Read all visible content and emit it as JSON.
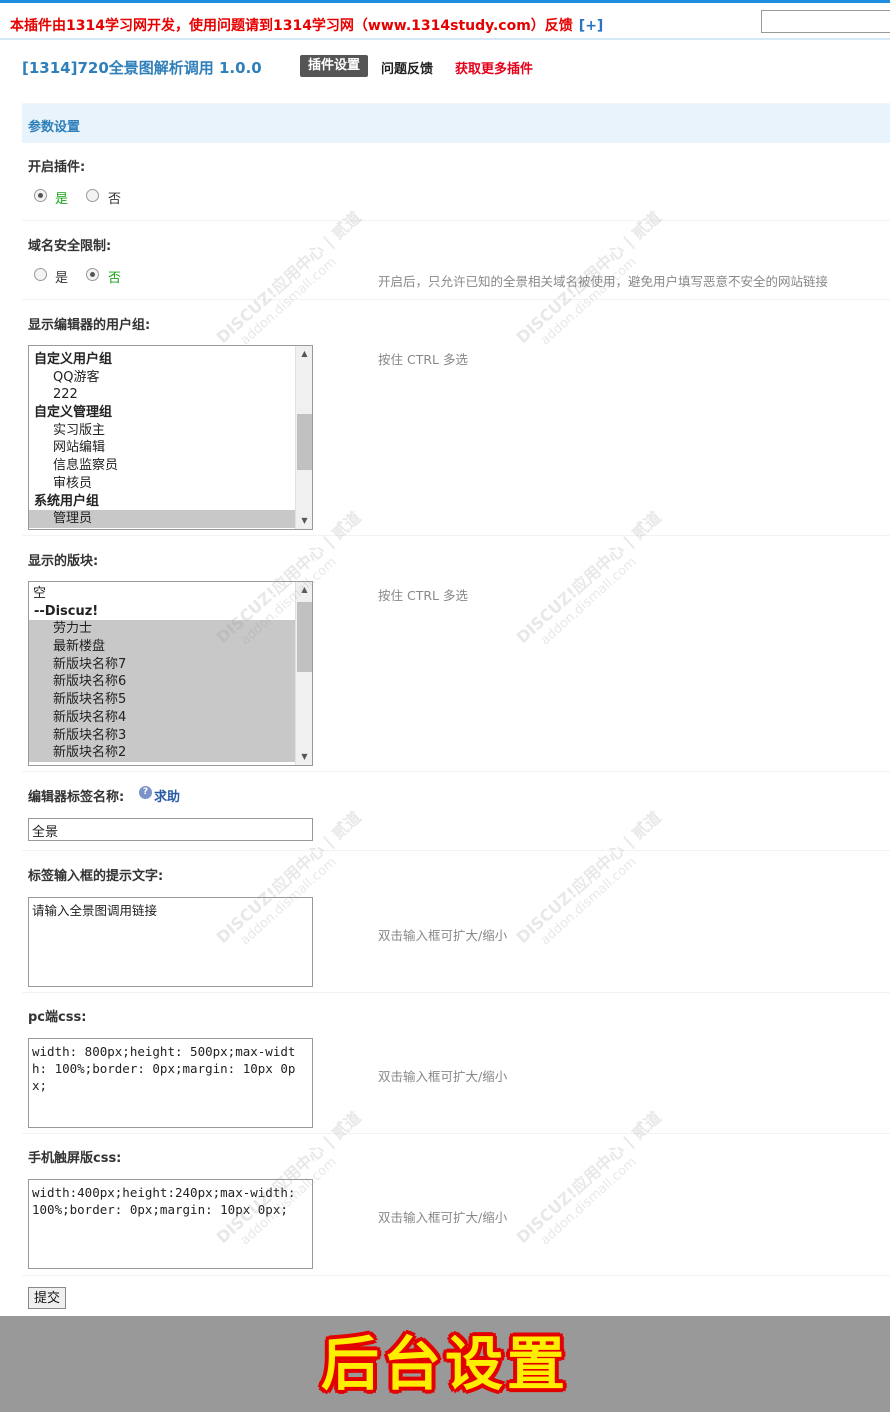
{
  "topbar": {
    "notice": "本插件由1314学习网开发，使用问题请到1314学习网（www.1314study.com）反馈",
    "plus": "[+]"
  },
  "header": {
    "title": "[1314]720全景图解析调用 1.0.0",
    "tabs": [
      "插件设置",
      "问题反馈",
      "获取更多插件"
    ]
  },
  "section": {
    "title": "参数设置"
  },
  "fields": {
    "enable": {
      "label": "开启插件:",
      "options": [
        "是",
        "否"
      ],
      "selected": "是"
    },
    "domain": {
      "label": "域名安全限制:",
      "options": [
        "是",
        "否"
      ],
      "selected": "否",
      "hint": "开启后，只允许已知的全景相关域名被使用，避免用户填写恶意不安全的网站链接"
    },
    "groups": {
      "label": "显示编辑器的用户组:",
      "hint": "按住 CTRL 多选",
      "items": [
        {
          "text": "自定义用户组",
          "type": "group"
        },
        {
          "text": "QQ游客",
          "type": "item"
        },
        {
          "text": "222",
          "type": "item"
        },
        {
          "text": "自定义管理组",
          "type": "group"
        },
        {
          "text": "实习版主",
          "type": "item"
        },
        {
          "text": "网站编辑",
          "type": "item"
        },
        {
          "text": "信息监察员",
          "type": "item"
        },
        {
          "text": "审核员",
          "type": "item"
        },
        {
          "text": "系统用户组",
          "type": "group"
        },
        {
          "text": "管理员",
          "type": "item",
          "selected": true
        }
      ]
    },
    "forums": {
      "label": "显示的版块:",
      "hint": "按住 CTRL 多选",
      "items": [
        {
          "text": "空",
          "type": "empty"
        },
        {
          "text": "--Discuz!",
          "type": "group"
        },
        {
          "text": "劳力士",
          "type": "item",
          "selected": true
        },
        {
          "text": "最新楼盘",
          "type": "item",
          "selected": true
        },
        {
          "text": "新版块名称7",
          "type": "item",
          "selected": true
        },
        {
          "text": "新版块名称6",
          "type": "item",
          "selected": true
        },
        {
          "text": "新版块名称5",
          "type": "item",
          "selected": true
        },
        {
          "text": "新版块名称4",
          "type": "item",
          "selected": true
        },
        {
          "text": "新版块名称3",
          "type": "item",
          "selected": true
        },
        {
          "text": "新版块名称2",
          "type": "item",
          "selected": true
        }
      ]
    },
    "tag_name": {
      "label": "编辑器标签名称:",
      "help": "求助",
      "value": "全景"
    },
    "tag_placeholder": {
      "label": "标签输入框的提示文字:",
      "value": "请输入全景图调用链接",
      "hint": "双击输入框可扩大/缩小"
    },
    "pc_css": {
      "label": "pc端css:",
      "value": "width: 800px;height: 500px;max-width: 100%;border: 0px;margin: 10px 0px;",
      "hint": "双击输入框可扩大/缩小"
    },
    "mobile_css": {
      "label": "手机触屏版css:",
      "value": "width:400px;height:240px;max-width: 100%;border: 0px;margin: 10px 0px;",
      "hint": "双击输入框可扩大/缩小"
    }
  },
  "submit_label": "提交",
  "footer": {
    "caption": "后台设置"
  },
  "watermark": {
    "brand": "DISCUZ!应用中心 | 贰道",
    "url": "addon.dismall.com"
  }
}
